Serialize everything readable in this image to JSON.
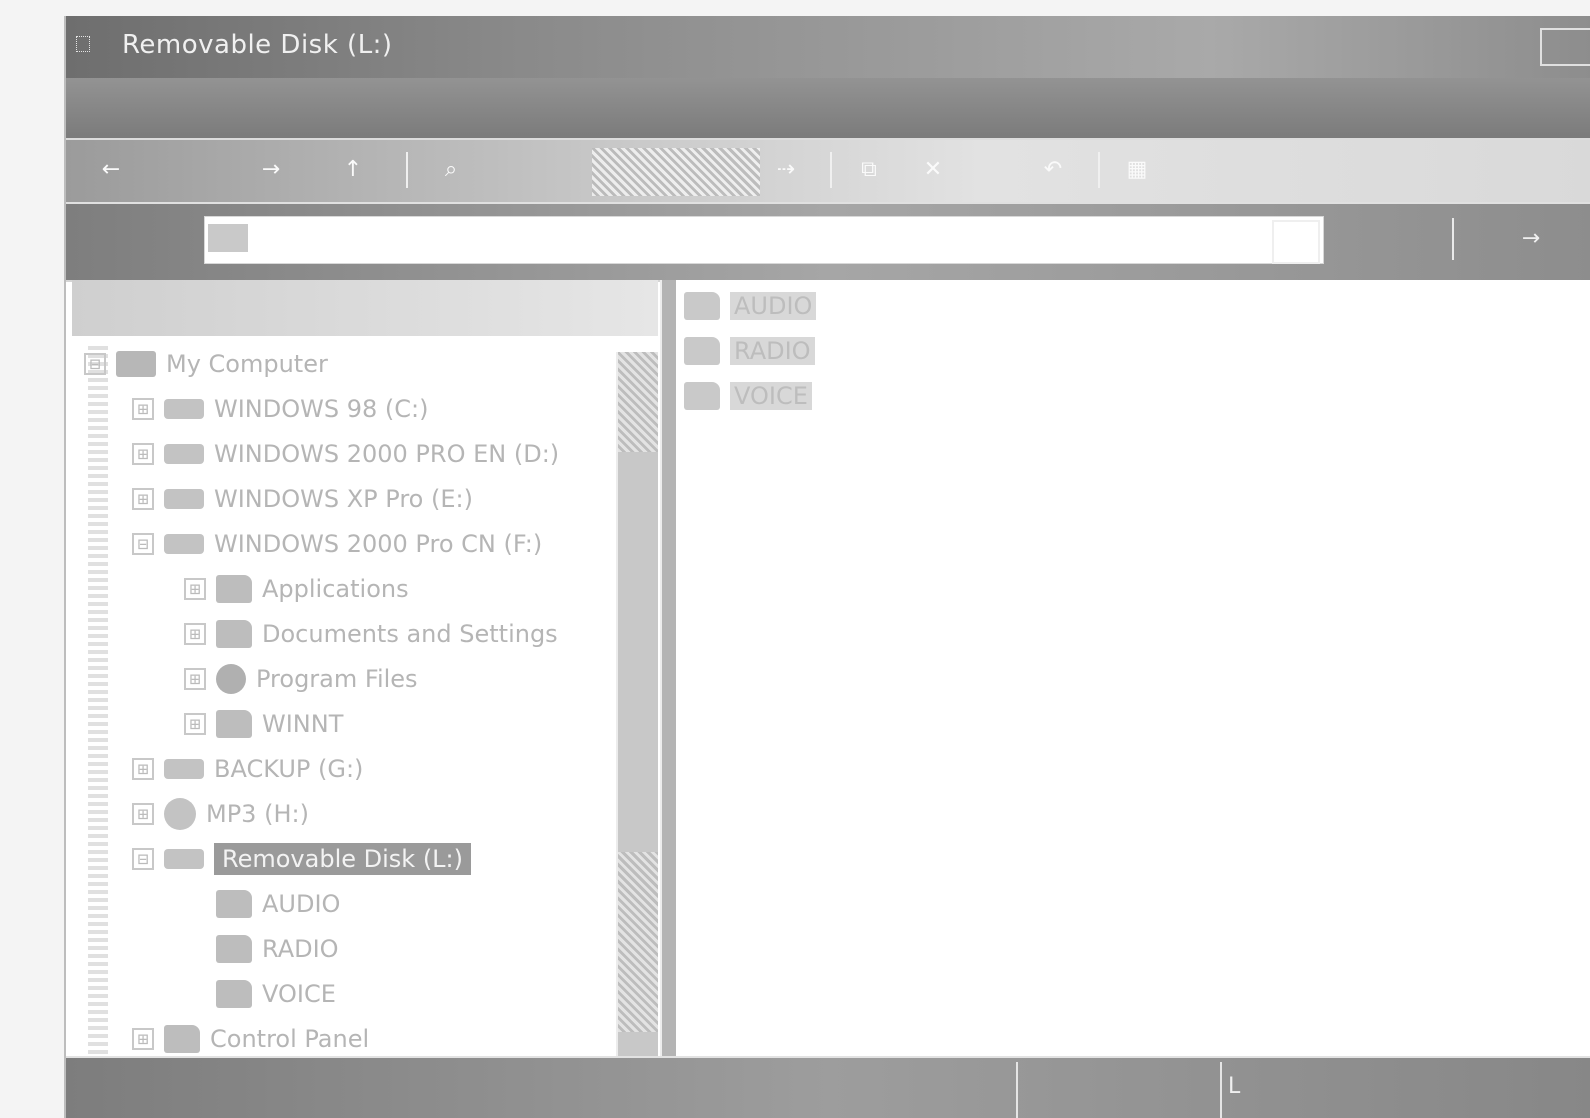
{
  "window": {
    "title": "Removable Disk (L:)"
  },
  "address": {
    "value": ""
  },
  "toolbar": {
    "back": "←",
    "forward": "→",
    "up": "↑",
    "search": "⌕",
    "folders": "▤",
    "move": "⇢",
    "copy": "⧉",
    "delete": "✕",
    "undo": "↶",
    "views": "▦"
  },
  "go_button": "→",
  "tree": {
    "items": [
      {
        "label": "My Computer",
        "expander": "⊟",
        "icon": "computer"
      },
      {
        "label": "WINDOWS 98 (C:)",
        "expander": "⊞",
        "icon": "drive"
      },
      {
        "label": "WINDOWS 2000 PRO EN (D:)",
        "expander": "⊞",
        "icon": "drive"
      },
      {
        "label": "WINDOWS XP Pro (E:)",
        "expander": "⊞",
        "icon": "drive"
      },
      {
        "label": "WINDOWS 2000 Pro CN (F:)",
        "expander": "⊟",
        "icon": "drive"
      },
      {
        "label": "Applications",
        "expander": "⊞",
        "icon": "folder"
      },
      {
        "label": "Documents and Settings",
        "expander": "⊞",
        "icon": "folder"
      },
      {
        "label": "Program Files",
        "expander": "⊞",
        "icon": "globe"
      },
      {
        "label": "WINNT",
        "expander": "⊞",
        "icon": "folder"
      },
      {
        "label": "BACKUP (G:)",
        "expander": "⊞",
        "icon": "drive"
      },
      {
        "label": "MP3 (H:)",
        "expander": "⊞",
        "icon": "cd"
      },
      {
        "label": "Removable Disk (L:)",
        "expander": "⊟",
        "icon": "drive",
        "selected": true
      },
      {
        "label": "AUDIO",
        "expander": "",
        "icon": "folder"
      },
      {
        "label": "RADIO",
        "expander": "",
        "icon": "folder"
      },
      {
        "label": "VOICE",
        "expander": "",
        "icon": "folder"
      },
      {
        "label": "Control Panel",
        "expander": "⊞",
        "icon": "folder"
      }
    ]
  },
  "list": {
    "items": [
      {
        "label": "AUDIO"
      },
      {
        "label": "RADIO"
      },
      {
        "label": "VOICE"
      }
    ]
  },
  "status": {
    "text": "L"
  }
}
